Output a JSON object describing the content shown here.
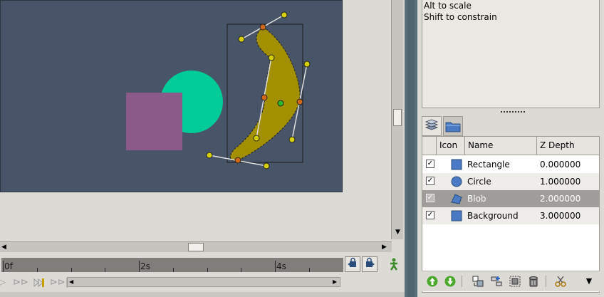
{
  "window": {
    "accent_blob": "#a39000",
    "canvas_bg": "#485569"
  },
  "tooltip": {
    "lines": [
      "Alt to scale",
      "Shift to constrain"
    ]
  },
  "timeline": {
    "labels": [
      "0f",
      "2s",
      "4s"
    ]
  },
  "layers": {
    "columns": {
      "icon": "Icon",
      "name": "Name",
      "z": "Z Depth"
    },
    "rows": [
      {
        "name": "Rectangle",
        "z": "0.000000",
        "checked": true,
        "icon": "rectangle-layer-icon",
        "selected": false
      },
      {
        "name": "Circle",
        "z": "1.000000",
        "checked": true,
        "icon": "circle-layer-icon",
        "selected": false
      },
      {
        "name": "Blob",
        "z": "2.000000",
        "checked": true,
        "icon": "region-layer-icon",
        "selected": true
      },
      {
        "name": "Background",
        "z": "3.000000",
        "checked": true,
        "icon": "rectangle-layer-icon",
        "selected": false
      }
    ]
  },
  "colors": {
    "rectangle": "#8b5a88",
    "circle": "#00cc99",
    "blob": "#a39000",
    "selection_row": "#9f9d99",
    "divider": "#59707a"
  }
}
